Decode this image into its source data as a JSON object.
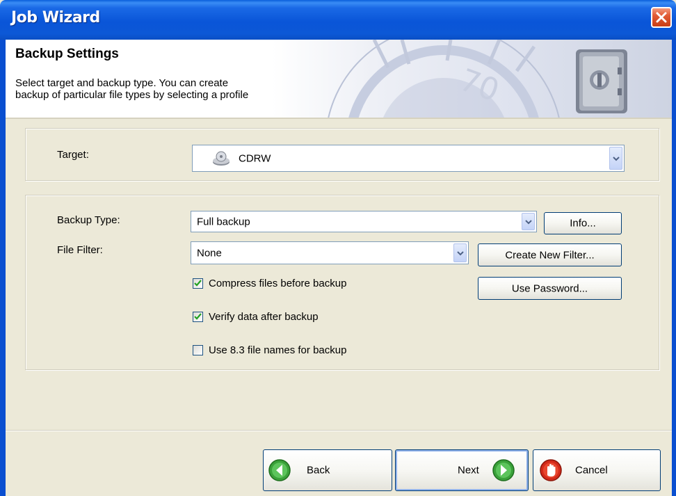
{
  "window": {
    "title": "Job Wizard"
  },
  "header": {
    "title": "Backup Settings",
    "description_line1": "Select target and backup type. You can create",
    "description_line2": "backup of particular file types by selecting a profile"
  },
  "target": {
    "label": "Target:",
    "value": "CDRW",
    "icon": "cd-drive-icon"
  },
  "backup": {
    "type_label": "Backup Type:",
    "type_value": "Full backup",
    "info_button": "Info...",
    "filter_label": "File Filter:",
    "filter_value": "None",
    "create_filter_button": "Create New Filter...",
    "use_password_button": "Use Password...",
    "options": [
      {
        "label": "Compress files before backup",
        "checked": true
      },
      {
        "label": "Verify data after backup",
        "checked": true
      },
      {
        "label": "Use 8.3 file names for backup",
        "checked": false
      }
    ]
  },
  "nav": {
    "back": "Back",
    "next": "Next",
    "cancel": "Cancel"
  },
  "colors": {
    "titlebar": "#0a5fdb",
    "accent_green": "#3aa13a",
    "cancel_red": "#d32a1a",
    "face": "#ece9d8"
  }
}
